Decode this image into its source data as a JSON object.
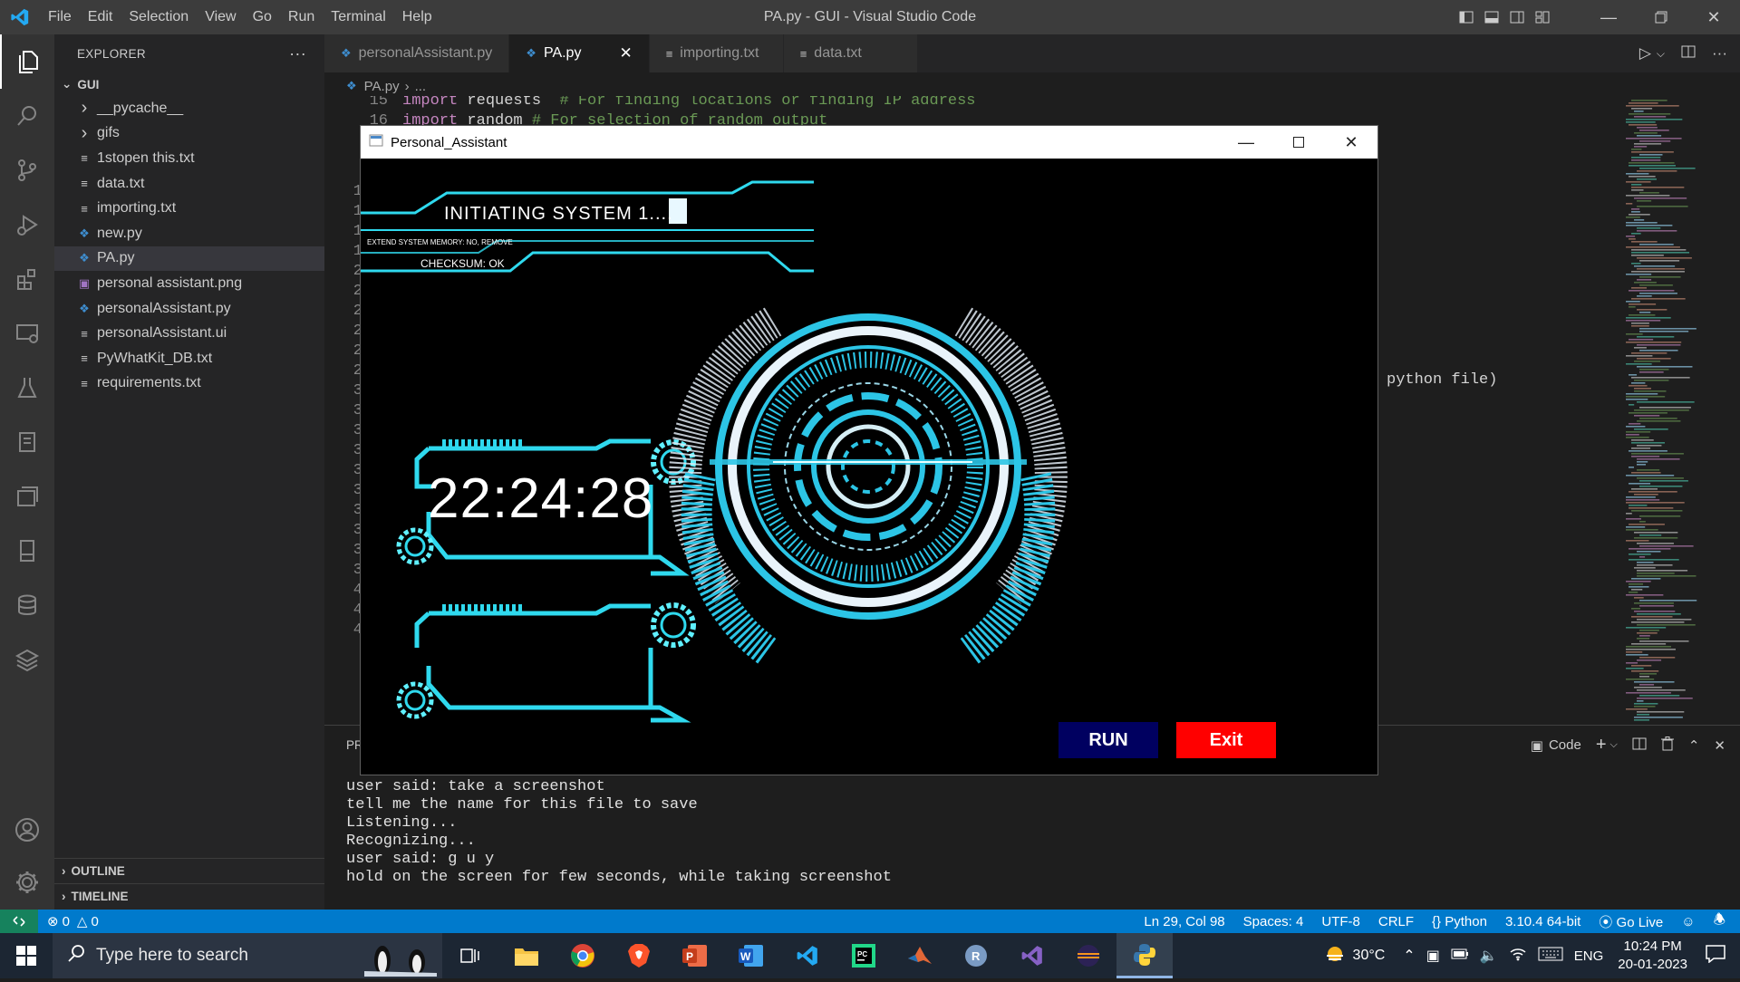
{
  "titlebar": {
    "menu": [
      "File",
      "Edit",
      "Selection",
      "View",
      "Go",
      "Run",
      "Terminal",
      "Help"
    ],
    "title": "PA.py - GUI - Visual Studio Code"
  },
  "sidebar": {
    "header": "EXPLORER",
    "more": "···",
    "folder": "GUI",
    "items": [
      {
        "label": "__pycache__",
        "kind": "folder"
      },
      {
        "label": "gifs",
        "kind": "folder"
      },
      {
        "label": "1stopen this.txt",
        "kind": "txt"
      },
      {
        "label": "data.txt",
        "kind": "txt"
      },
      {
        "label": "importing.txt",
        "kind": "txt"
      },
      {
        "label": "new.py",
        "kind": "py"
      },
      {
        "label": "PA.py",
        "kind": "py",
        "active": true
      },
      {
        "label": "personal assistant.png",
        "kind": "png"
      },
      {
        "label": "personalAssistant.py",
        "kind": "py"
      },
      {
        "label": "personalAssistant.ui",
        "kind": "txt"
      },
      {
        "label": "PyWhatKit_DB.txt",
        "kind": "txt"
      },
      {
        "label": "requirements.txt",
        "kind": "txt"
      }
    ],
    "outline": "OUTLINE",
    "timeline": "TIMELINE"
  },
  "tabs": [
    {
      "label": "personalAssistant.py",
      "kind": "py"
    },
    {
      "label": "PA.py",
      "kind": "py",
      "active": true
    },
    {
      "label": "importing.txt",
      "kind": "txt"
    },
    {
      "label": "data.txt",
      "kind": "txt"
    }
  ],
  "breadcrumb": {
    "file": "PA.py",
    "rest": "..."
  },
  "editor": {
    "lines": [
      {
        "num": "15",
        "kw": "import",
        "rest": " requests  ",
        "comment": "# For finding locations or finding IP address"
      },
      {
        "num": "16",
        "kw": "import",
        "rest": " random ",
        "comment": "# For selection of random output"
      }
    ],
    "visible_gutter": [
      "1",
      "1",
      "1",
      "1",
      "2",
      "2",
      "2",
      "2",
      "2",
      "2",
      "3",
      "3",
      "3",
      "3",
      "3",
      "3",
      "3",
      "3",
      "3",
      "3",
      "4",
      "4",
      "4"
    ],
    "partial_line": "python file)"
  },
  "panel": {
    "title": "PR",
    "terminal_label": "Code",
    "output": [
      "user said: take a screenshot",
      "tell me the name for this file to save",
      "Listening...",
      "Recognizing...",
      "user said: g u y",
      "hold on the screen for few seconds, while taking screenshot"
    ]
  },
  "statusbar": {
    "errors": "0",
    "warnings": "0",
    "position": "Ln 29, Col 98",
    "spaces": "Spaces: 4",
    "encoding": "UTF-8",
    "eol": "CRLF",
    "language": "Python",
    "interpreter": "3.10.4 64-bit",
    "golive": "Go Live"
  },
  "app": {
    "title": "Personal_Assistant",
    "hud_line1": "INITIATING SYSTEM 1....",
    "hud_line2": "EXTEND SYSTEM MEMORY: NO, REMOVE",
    "hud_line3": "CHECKSUM: OK",
    "clock": "22:24:28",
    "run_label": "RUN",
    "exit_label": "Exit",
    "colors": {
      "run_bg": "#000060",
      "exit_bg": "#ff0000",
      "hud": "#2fd9ee"
    }
  },
  "taskbar": {
    "search_placeholder": "Type here to search",
    "weather": "30°C",
    "language": "ENG",
    "time": "10:24 PM",
    "date": "20-01-2023"
  }
}
